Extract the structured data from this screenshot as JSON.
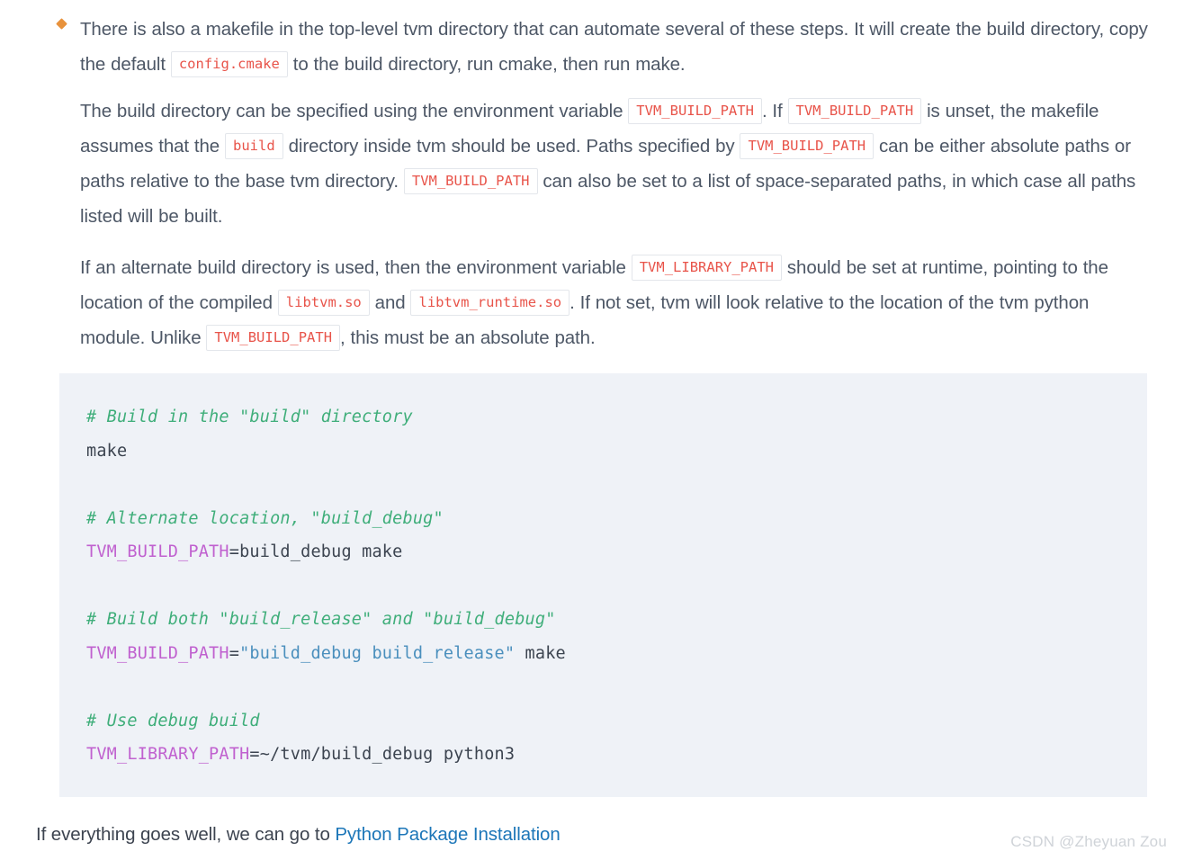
{
  "bullet": {
    "marker": "diamond-bullet",
    "paragraph_parts": [
      {
        "type": "text",
        "value": "There is also a makefile in the top-level tvm directory that can automate several of these steps. It will create the build directory, copy the default "
      },
      {
        "type": "code",
        "value": "config.cmake"
      },
      {
        "type": "text",
        "value": " to the build directory, run cmake, then run make."
      }
    ]
  },
  "paragraphs": [
    {
      "id": "build-directory-paragraph",
      "parts": [
        {
          "type": "text",
          "value": "The build directory can be specified using the environment variable "
        },
        {
          "type": "code",
          "value": "TVM_BUILD_PATH"
        },
        {
          "type": "text",
          "value": ". If "
        },
        {
          "type": "code",
          "value": "TVM_BUILD_PATH"
        },
        {
          "type": "text",
          "value": " is unset, the makefile assumes that the "
        },
        {
          "type": "code",
          "value": "build"
        },
        {
          "type": "text",
          "value": " directory inside tvm should be used. Paths specified by "
        },
        {
          "type": "code",
          "value": "TVM_BUILD_PATH"
        },
        {
          "type": "text",
          "value": " can be either absolute paths or paths relative to the base tvm directory. "
        },
        {
          "type": "code",
          "value": "TVM_BUILD_PATH"
        },
        {
          "type": "text",
          "value": " can also be set to a list of space-separated paths, in which case all paths listed will be built."
        }
      ]
    },
    {
      "id": "library-path-paragraph",
      "parts": [
        {
          "type": "text",
          "value": "If an alternate build directory is used, then the environment variable "
        },
        {
          "type": "code",
          "value": "TVM_LIBRARY_PATH"
        },
        {
          "type": "text",
          "value": " should be set at runtime, pointing to the location of the compiled "
        },
        {
          "type": "code",
          "value": "libtvm.so"
        },
        {
          "type": "text",
          "value": " and "
        },
        {
          "type": "code",
          "value": "libtvm_runtime.so"
        },
        {
          "type": "text",
          "value": ". If not set, tvm will look relative to the location of the tvm python module. Unlike "
        },
        {
          "type": "code",
          "value": "TVM_BUILD_PATH"
        },
        {
          "type": "text",
          "value": ", this must be an absolute path."
        }
      ]
    }
  ],
  "code_block": {
    "language": "bash",
    "lines": [
      {
        "tokens": [
          {
            "type": "comment",
            "value": "# Build in the \"build\" directory"
          }
        ]
      },
      {
        "tokens": [
          {
            "type": "plain",
            "value": "make"
          }
        ]
      },
      {
        "tokens": []
      },
      {
        "tokens": [
          {
            "type": "comment",
            "value": "# Alternate location, \"build_debug\""
          }
        ]
      },
      {
        "tokens": [
          {
            "type": "var",
            "value": "TVM_BUILD_PATH"
          },
          {
            "type": "plain",
            "value": "=build_debug make"
          }
        ]
      },
      {
        "tokens": []
      },
      {
        "tokens": [
          {
            "type": "comment",
            "value": "# Build both \"build_release\" and \"build_debug\""
          }
        ]
      },
      {
        "tokens": [
          {
            "type": "var",
            "value": "TVM_BUILD_PATH"
          },
          {
            "type": "plain",
            "value": "="
          },
          {
            "type": "str",
            "value": "\"build_debug build_release\""
          },
          {
            "type": "plain",
            "value": " make"
          }
        ]
      },
      {
        "tokens": []
      },
      {
        "tokens": [
          {
            "type": "comment",
            "value": "# Use debug build"
          }
        ]
      },
      {
        "tokens": [
          {
            "type": "var",
            "value": "TVM_LIBRARY_PATH"
          },
          {
            "type": "plain",
            "value": "=~/tvm/build_debug python3"
          }
        ]
      }
    ]
  },
  "footer": {
    "text_before_link": "If everything goes well, we can go to ",
    "link_text": "Python Package Installation"
  },
  "watermark": {
    "text": "CSDN @Zheyuan Zou"
  },
  "colors": {
    "inline_code_text": "#e8544a",
    "code_comment": "#3fae7a",
    "code_variable": "#c061cf",
    "code_string": "#4a8fbd",
    "code_background": "#eff2f7",
    "link": "#1c76b8",
    "bullet": "#e8923c",
    "body_text": "#4d5766"
  }
}
